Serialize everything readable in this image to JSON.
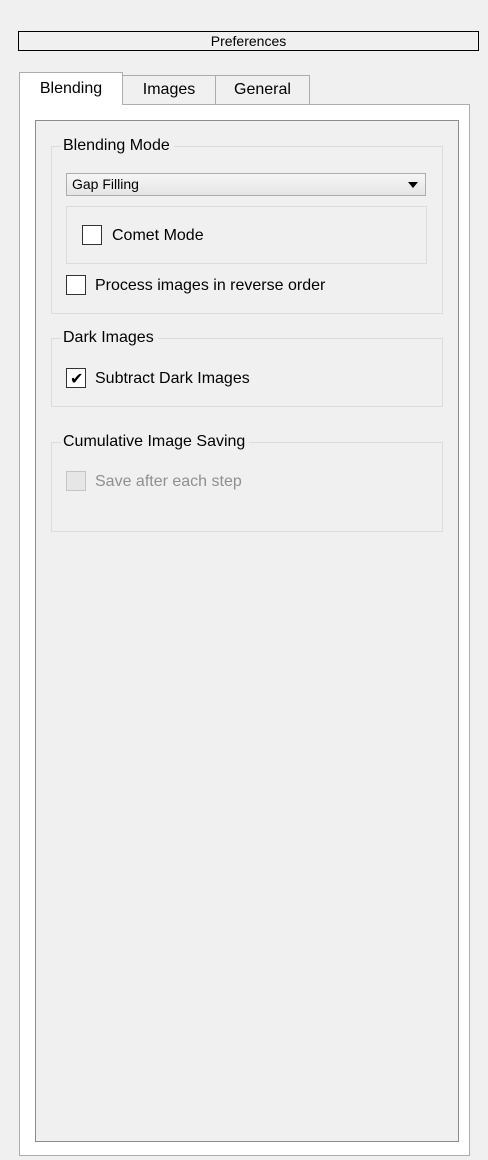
{
  "window": {
    "title": "Preferences"
  },
  "tabs": [
    {
      "label": "Blending",
      "active": true
    },
    {
      "label": "Images",
      "active": false
    },
    {
      "label": "General",
      "active": false
    }
  ],
  "blending_mode": {
    "group_title": "Blending Mode",
    "mode_select": {
      "value": "Gap Filling"
    },
    "comet_mode": {
      "label": "Comet Mode",
      "checked": false
    },
    "reverse_order": {
      "label": "Process images in reverse order",
      "checked": false
    }
  },
  "dark_images": {
    "group_title": "Dark Images",
    "subtract": {
      "label": "Subtract Dark Images",
      "checked": true
    }
  },
  "cumulative_saving": {
    "group_title": "Cumulative Image Saving",
    "save_each_step": {
      "label": "Save after each step",
      "checked": false,
      "enabled": false
    }
  },
  "icons": {
    "checkmark": "✔",
    "dropdown": "chevron-down-icon"
  }
}
